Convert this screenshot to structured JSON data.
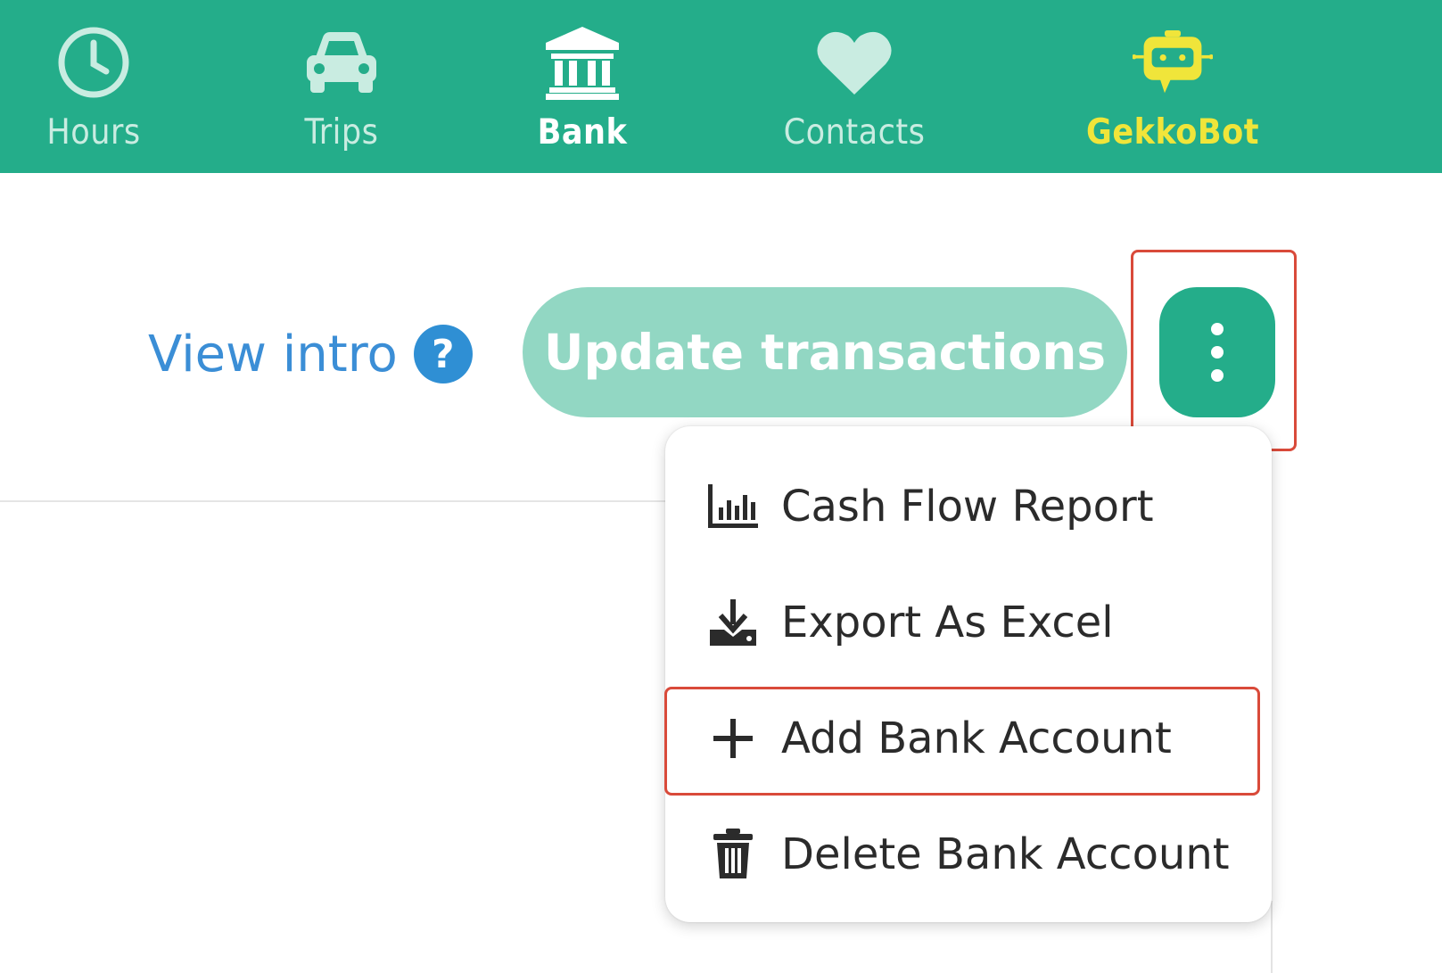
{
  "nav": {
    "items": [
      {
        "label": "Hours",
        "icon": "clock-icon"
      },
      {
        "label": "Trips",
        "icon": "car-icon"
      },
      {
        "label": "Bank",
        "icon": "bank-icon",
        "active": true
      },
      {
        "label": "Contacts",
        "icon": "heart-icon"
      },
      {
        "label": "GekkoBot",
        "icon": "robot-icon"
      }
    ]
  },
  "toolbar": {
    "view_intro": "View intro",
    "help_glyph": "?",
    "update_label": "Update transactions",
    "more_icon": "kebab-menu-icon"
  },
  "menu": {
    "items": [
      {
        "label": "Cash Flow Report",
        "icon": "bar-chart-icon"
      },
      {
        "label": "Export As Excel",
        "icon": "download-icon"
      },
      {
        "label": "Add Bank Account",
        "icon": "plus-icon"
      },
      {
        "label": "Delete Bank Account",
        "icon": "trash-icon"
      }
    ]
  },
  "colors": {
    "brand": "#24ad8a",
    "brand_light": "#92d7c3",
    "link": "#3b8ed6",
    "highlight": "#d94a3a",
    "gekko": "#f0e53a"
  }
}
